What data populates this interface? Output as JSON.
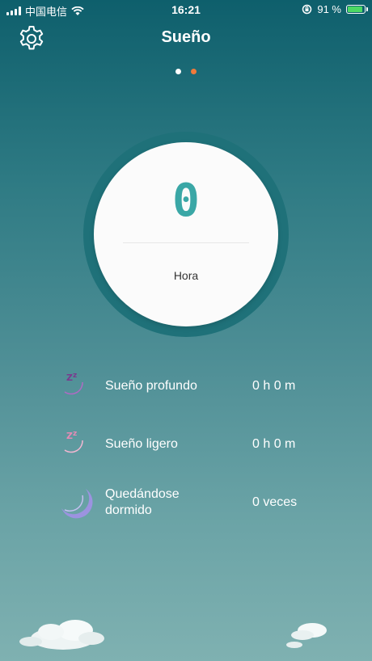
{
  "status": {
    "carrier": "中国电信",
    "time": "16:21",
    "battery_percent": "91 %",
    "battery_level": 0.91
  },
  "header": {
    "title": "Sueño",
    "settings_icon": "gear-icon"
  },
  "pager": {
    "active_index": 1,
    "colors": [
      "#ffffff",
      "#f07a3a"
    ]
  },
  "dial": {
    "value": "0",
    "unit": "Hora"
  },
  "stats": [
    {
      "icon": "moon-zzz-deep-icon",
      "label": "Sueño profundo",
      "value": "0 h 0 m",
      "color": "#7a3a8e"
    },
    {
      "icon": "moon-zzz-light-icon",
      "label": "Sueño ligero",
      "value": "0 h 0 m",
      "color": "#e58bb5"
    },
    {
      "icon": "moon-icon",
      "label": "Quedándose dormido",
      "value": "0 veces",
      "color": "#9c93e0"
    }
  ]
}
